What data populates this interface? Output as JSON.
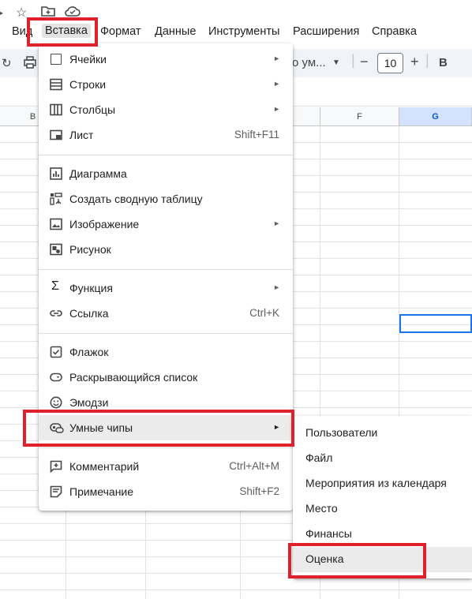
{
  "menubar": {
    "items": [
      "Вид",
      "Вставка",
      "Формат",
      "Данные",
      "Инструменты",
      "Расширения",
      "Справка"
    ]
  },
  "toolbar": {
    "font_label": "о ум...",
    "font_size": "10",
    "minus": "−",
    "plus": "+",
    "bold": "B"
  },
  "columns": {
    "b": "B",
    "f": "F",
    "g": "G"
  },
  "insert_menu": {
    "items": [
      {
        "label": "Ячейки",
        "submenu": true
      },
      {
        "label": "Строки",
        "submenu": true
      },
      {
        "label": "Столбцы",
        "submenu": true
      },
      {
        "label": "Лист",
        "shortcut": "Shift+F11"
      },
      {
        "label": "Диаграмма"
      },
      {
        "label": "Создать сводную таблицу"
      },
      {
        "label": "Изображение",
        "submenu": true
      },
      {
        "label": "Рисунок"
      },
      {
        "label": "Функция",
        "submenu": true
      },
      {
        "label": "Ссылка",
        "shortcut": "Ctrl+K"
      },
      {
        "label": "Флажок"
      },
      {
        "label": "Раскрывающийся список"
      },
      {
        "label": "Эмодзи"
      },
      {
        "label": "Умные чипы",
        "submenu": true,
        "highlighted": true
      },
      {
        "label": "Комментарий",
        "shortcut": "Ctrl+Alt+M"
      },
      {
        "label": "Примечание",
        "shortcut": "Shift+F2"
      }
    ]
  },
  "smart_chips_menu": {
    "items": [
      "Пользователи",
      "Файл",
      "Мероприятия из календаря",
      "Место",
      "Финансы",
      "Оценка"
    ],
    "highlighted": "Оценка"
  },
  "colors": {
    "highlight_box": "#e0202a",
    "selection": "#1a73e8",
    "toolbar_bg": "#f0f4f9"
  }
}
